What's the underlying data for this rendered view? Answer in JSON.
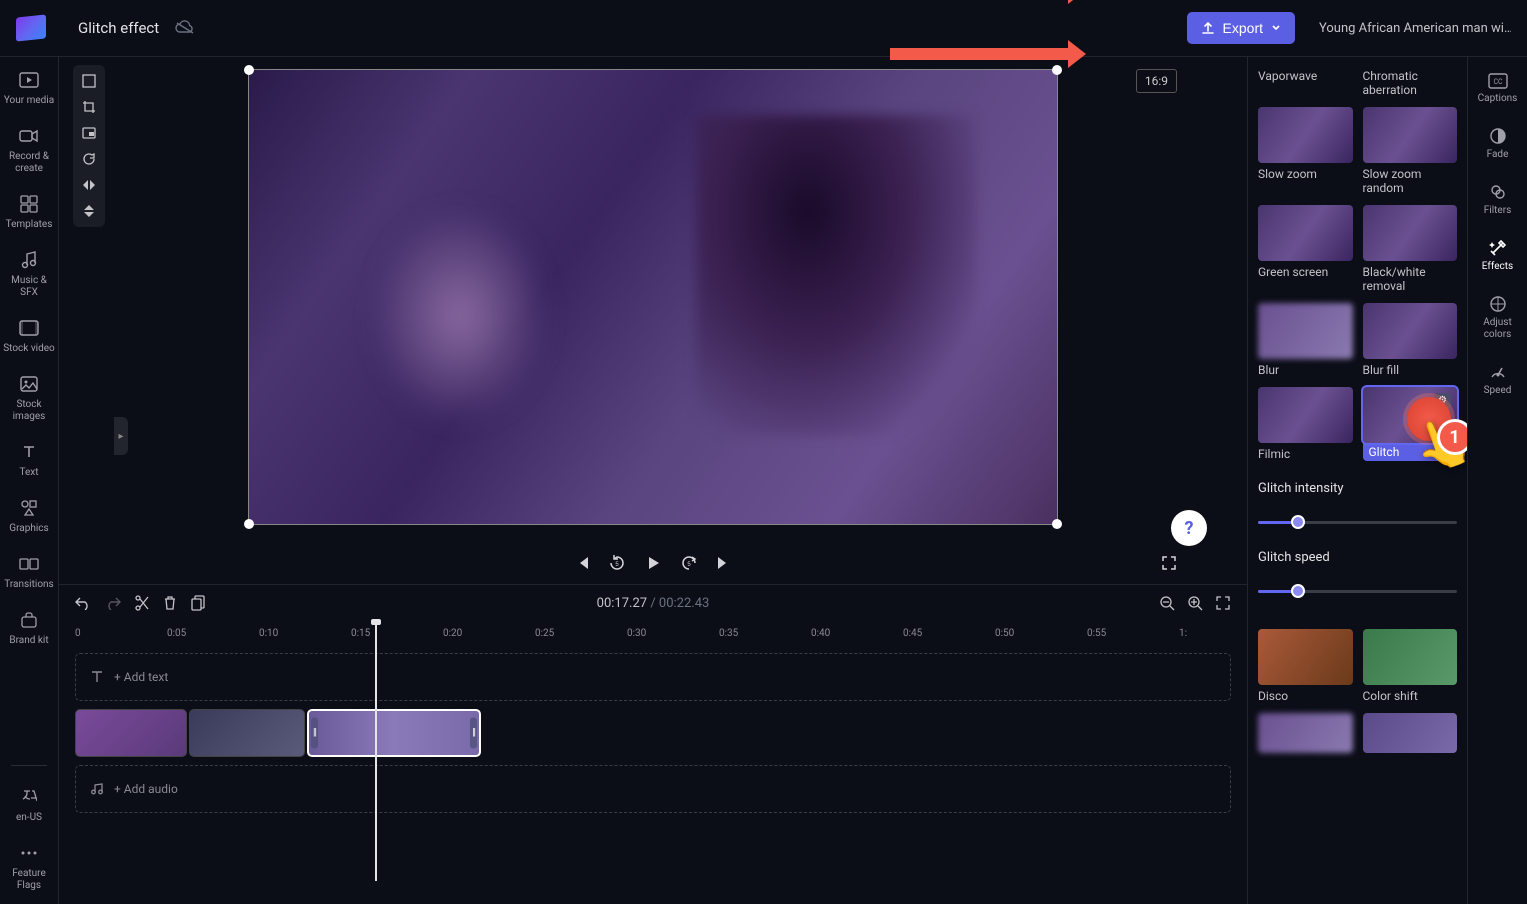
{
  "header": {
    "title": "Glitch effect",
    "export_label": "Export",
    "clip_title": "Young African American man wi…",
    "aspect_ratio": "16:9"
  },
  "sidebar_left": {
    "items": [
      {
        "label": "Your media",
        "icon": "media"
      },
      {
        "label": "Record & create",
        "icon": "record"
      },
      {
        "label": "Templates",
        "icon": "templates"
      },
      {
        "label": "Music & SFX",
        "icon": "music"
      },
      {
        "label": "Stock video",
        "icon": "stock-video"
      },
      {
        "label": "Stock images",
        "icon": "stock-images"
      },
      {
        "label": "Text",
        "icon": "text"
      },
      {
        "label": "Graphics",
        "icon": "graphics"
      },
      {
        "label": "Transitions",
        "icon": "transitions"
      },
      {
        "label": "Brand kit",
        "icon": "brand-kit"
      }
    ],
    "footer": [
      {
        "label": "en-US",
        "icon": "lang"
      },
      {
        "label": "Feature Flags",
        "icon": "more"
      }
    ]
  },
  "playback": {
    "current": "00:17.27",
    "duration": "00:22.43"
  },
  "timeline": {
    "ruler": [
      "0",
      "0:05",
      "0:10",
      "0:15",
      "0:20",
      "0:25",
      "0:30",
      "0:35",
      "0:40",
      "0:45",
      "0:50",
      "0:55",
      "1:"
    ],
    "add_text": "+ Add text",
    "add_audio": "+ Add audio"
  },
  "effects": {
    "items_top": [
      {
        "label": "Vaporwave",
        "thumb": "default"
      },
      {
        "label": "Chromatic aberration",
        "thumb": "default"
      },
      {
        "label": "Slow zoom",
        "thumb": "default"
      },
      {
        "label": "Slow zoom random",
        "thumb": "default"
      },
      {
        "label": "Green screen",
        "thumb": "default"
      },
      {
        "label": "Black/white removal",
        "thumb": "default"
      },
      {
        "label": "Blur",
        "thumb": "blur"
      },
      {
        "label": "Blur fill",
        "thumb": "default"
      },
      {
        "label": "Filmic",
        "thumb": "default"
      },
      {
        "label": "Glitch",
        "thumb": "selected"
      }
    ],
    "intensity_label": "Glitch intensity",
    "intensity_value": 20,
    "speed_label": "Glitch speed",
    "speed_value": 20,
    "items_bottom": [
      {
        "label": "Disco",
        "thumb": "disco"
      },
      {
        "label": "Color shift",
        "thumb": "color-shift"
      },
      {
        "label": "",
        "thumb": "blur"
      },
      {
        "label": "",
        "thumb": "cartoon"
      }
    ]
  },
  "tabs_right": {
    "items": [
      {
        "label": "Captions",
        "icon": "captions"
      },
      {
        "label": "Fade",
        "icon": "fade"
      },
      {
        "label": "Filters",
        "icon": "filters"
      },
      {
        "label": "Effects",
        "icon": "effects",
        "active": true
      },
      {
        "label": "Adjust colors",
        "icon": "adjust"
      },
      {
        "label": "Speed",
        "icon": "speed"
      }
    ]
  },
  "annotations": {
    "pointer_number": "1"
  }
}
